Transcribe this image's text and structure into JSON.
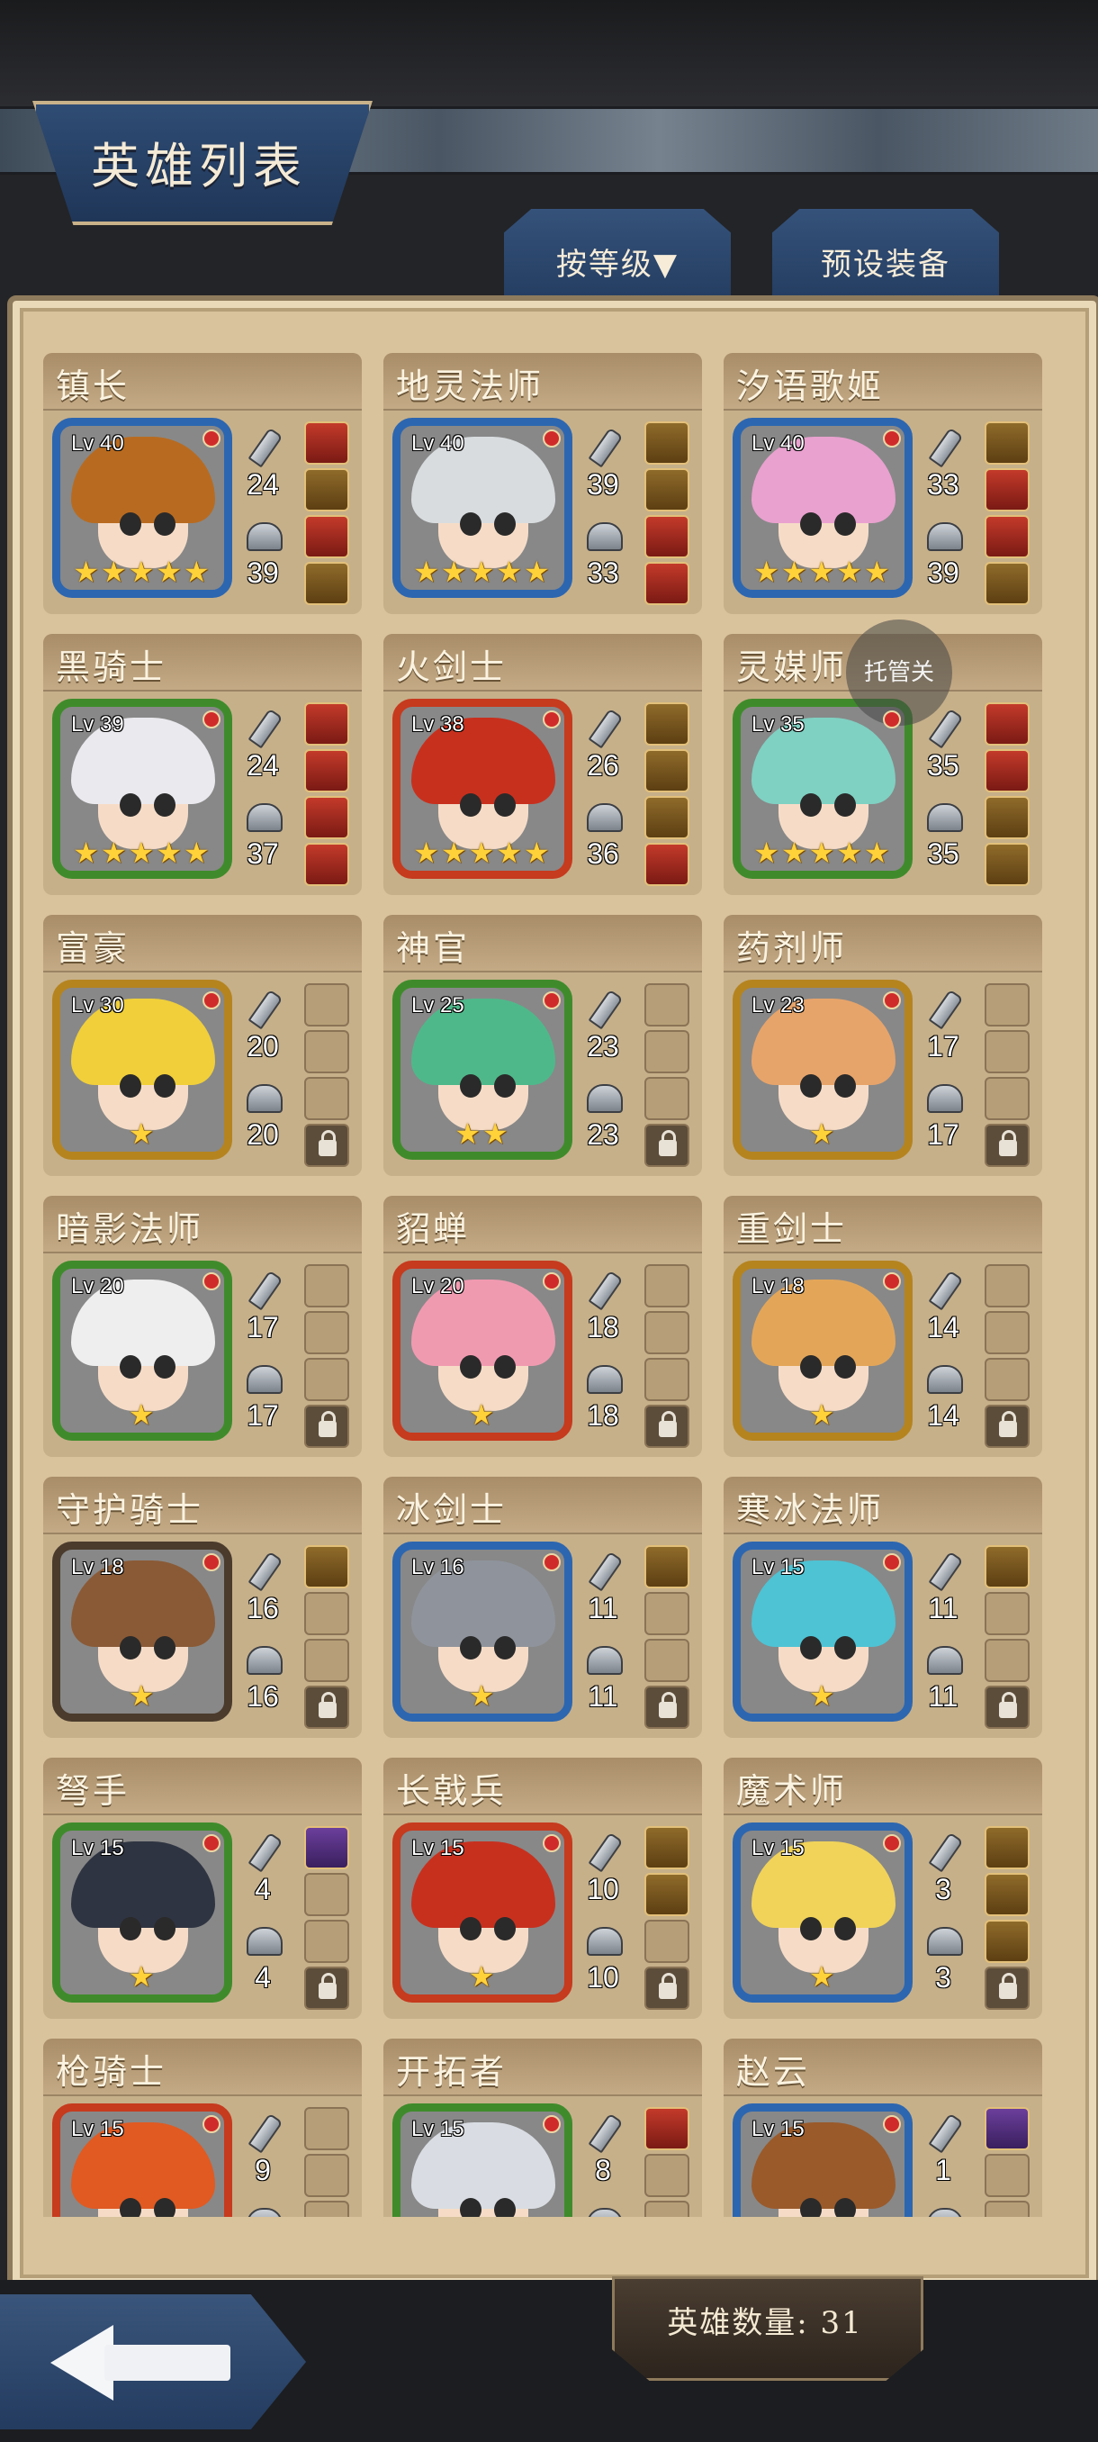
{
  "header": {
    "title": "英雄列表",
    "sort_tab": "按等级▼",
    "preset_tab": "预设装备"
  },
  "overlay": {
    "float_button": "托管关"
  },
  "footer": {
    "hero_count": "英雄数量: 31"
  },
  "heroes": [
    {
      "name": "镇长",
      "level": "Lv 40",
      "stars": 5,
      "atk": "24",
      "def": "39",
      "frame": "#2c66b0",
      "hair": "#b86b20",
      "slots": [
        "filled",
        "gold",
        "filled",
        "gold"
      ]
    },
    {
      "name": "地灵法师",
      "level": "Lv 40",
      "stars": 5,
      "atk": "39",
      "def": "33",
      "frame": "#2c66b0",
      "hair": "#d8dcdf",
      "slots": [
        "gold",
        "gold",
        "filled",
        "filled"
      ]
    },
    {
      "name": "汐语歌姬",
      "level": "Lv 40",
      "stars": 5,
      "atk": "33",
      "def": "39",
      "frame": "#2c66b0",
      "hair": "#e9a1cf",
      "slots": [
        "gold",
        "filled",
        "filled",
        "gold"
      ]
    },
    {
      "name": "黑骑士",
      "level": "Lv 39",
      "stars": 5,
      "atk": "24",
      "def": "37",
      "frame": "#3f8b2b",
      "hair": "#e9e9ee",
      "slots": [
        "filled",
        "filled",
        "filled",
        "filled"
      ]
    },
    {
      "name": "火剑士",
      "level": "Lv 38",
      "stars": 5,
      "atk": "26",
      "def": "36",
      "frame": "#c63a1e",
      "hair": "#c8301e",
      "slots": [
        "gold",
        "gold",
        "gold",
        "filled"
      ]
    },
    {
      "name": "灵媒师",
      "level": "Lv 35",
      "stars": 5,
      "atk": "35",
      "def": "35",
      "frame": "#3f8b2b",
      "hair": "#7fd1c2",
      "slots": [
        "filled",
        "filled",
        "gold",
        "gold"
      ]
    },
    {
      "name": "富豪",
      "level": "Lv 30",
      "stars": 1,
      "atk": "20",
      "def": "20",
      "frame": "#b5841f",
      "hair": "#f0cf3a",
      "slots": [
        "empty",
        "empty",
        "empty",
        "lock"
      ]
    },
    {
      "name": "神官",
      "level": "Lv 25",
      "stars": 2,
      "atk": "23",
      "def": "23",
      "frame": "#3f8b2b",
      "hair": "#4fb88a",
      "slots": [
        "empty",
        "empty",
        "empty",
        "lock"
      ]
    },
    {
      "name": "药剂师",
      "level": "Lv 23",
      "stars": 1,
      "atk": "17",
      "def": "17",
      "frame": "#b5841f",
      "hair": "#e7a46a",
      "slots": [
        "empty",
        "empty",
        "empty",
        "lock"
      ]
    },
    {
      "name": "暗影法师",
      "level": "Lv 20",
      "stars": 1,
      "atk": "17",
      "def": "17",
      "frame": "#3f8b2b",
      "hair": "#eeeeee",
      "slots": [
        "empty",
        "empty",
        "empty",
        "lock"
      ]
    },
    {
      "name": "貂蝉",
      "level": "Lv 20",
      "stars": 1,
      "atk": "18",
      "def": "18",
      "frame": "#c63a1e",
      "hair": "#f09ab0",
      "slots": [
        "empty",
        "empty",
        "empty",
        "lock"
      ]
    },
    {
      "name": "重剑士",
      "level": "Lv 18",
      "stars": 1,
      "atk": "14",
      "def": "14",
      "frame": "#b5841f",
      "hair": "#e3a659",
      "slots": [
        "empty",
        "empty",
        "empty",
        "lock"
      ]
    },
    {
      "name": "守护骑士",
      "level": "Lv 18",
      "stars": 1,
      "atk": "16",
      "def": "16",
      "frame": "#4a3b2c",
      "hair": "#8a5a36",
      "slots": [
        "gold",
        "empty",
        "empty",
        "lock"
      ]
    },
    {
      "name": "冰剑士",
      "level": "Lv 16",
      "stars": 1,
      "atk": "11",
      "def": "11",
      "frame": "#2c66b0",
      "hair": "#8f949c",
      "slots": [
        "gold",
        "empty",
        "empty",
        "lock"
      ]
    },
    {
      "name": "寒冰法师",
      "level": "Lv 15",
      "stars": 1,
      "atk": "11",
      "def": "11",
      "frame": "#2c66b0",
      "hair": "#4ec3d4",
      "slots": [
        "gold",
        "empty",
        "empty",
        "lock"
      ]
    },
    {
      "name": "弩手",
      "level": "Lv 15",
      "stars": 1,
      "atk": "4",
      "def": "4",
      "frame": "#3f8b2b",
      "hair": "#2f3442",
      "slots": [
        "purple",
        "empty",
        "empty",
        "lock"
      ]
    },
    {
      "name": "长戟兵",
      "level": "Lv 15",
      "stars": 1,
      "atk": "10",
      "def": "10",
      "frame": "#c63a1e",
      "hair": "#c8301e",
      "slots": [
        "gold",
        "gold",
        "empty",
        "lock"
      ]
    },
    {
      "name": "魔术师",
      "level": "Lv 15",
      "stars": 1,
      "atk": "3",
      "def": "3",
      "frame": "#2c66b0",
      "hair": "#f1d35a",
      "slots": [
        "gold",
        "gold",
        "gold",
        "lock"
      ]
    },
    {
      "name": "枪骑士",
      "level": "Lv 15",
      "stars": 1,
      "atk": "9",
      "def": "",
      "frame": "#c63a1e",
      "hair": "#e05a22",
      "slots": [
        "empty",
        "empty",
        "empty",
        "lock"
      ]
    },
    {
      "name": "开拓者",
      "level": "Lv 15",
      "stars": 1,
      "atk": "8",
      "def": "",
      "frame": "#3f8b2b",
      "hair": "#d9dde3",
      "slots": [
        "filled",
        "empty",
        "empty",
        "lock"
      ]
    },
    {
      "name": "赵云",
      "level": "Lv 15",
      "stars": 1,
      "atk": "1",
      "def": "",
      "frame": "#2c66b0",
      "hair": "#9a5a2a",
      "slots": [
        "purple",
        "empty",
        "empty",
        "lock"
      ]
    }
  ]
}
